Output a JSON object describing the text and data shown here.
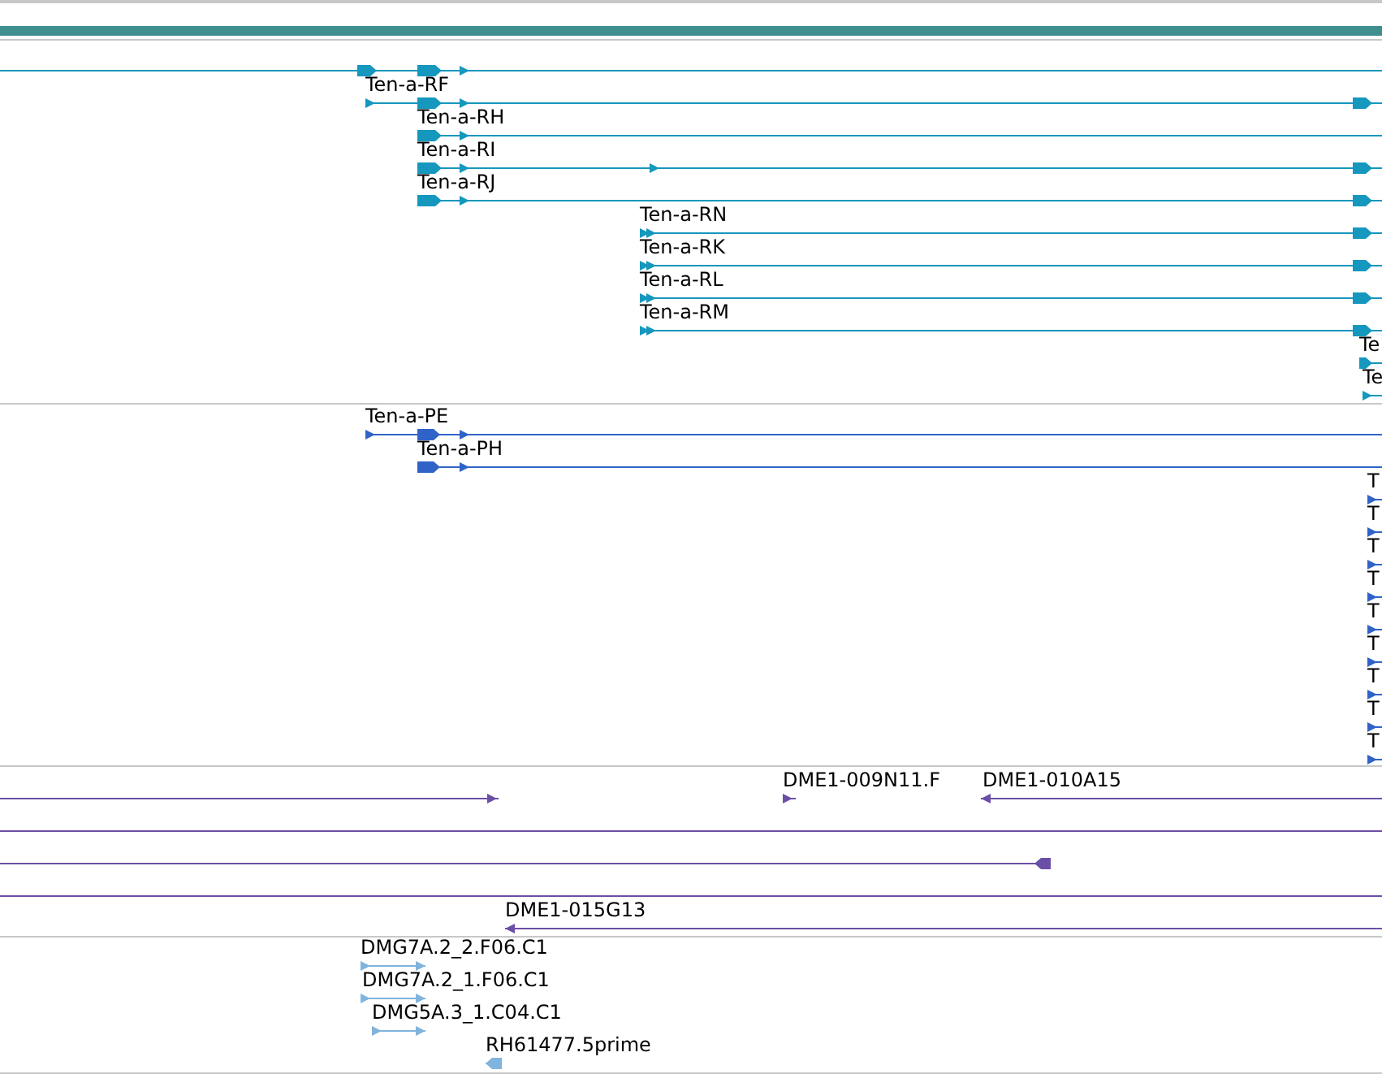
{
  "tracks": [
    {
      "color": "#1597be",
      "features": [
        {
          "kind": "gene",
          "reverse": false
        },
        {
          "kind": "gene",
          "reverse": false,
          "label": "Ten-a-RF"
        },
        {
          "kind": "gene",
          "reverse": false,
          "label": "Ten-a-RH"
        },
        {
          "kind": "gene",
          "reverse": false,
          "label": "Ten-a-RI"
        },
        {
          "kind": "gene",
          "reverse": false,
          "label": "Ten-a-RJ"
        },
        {
          "kind": "gene",
          "reverse": false,
          "label": "Ten-a-RN"
        },
        {
          "kind": "gene",
          "reverse": false,
          "label": "Ten-a-RK"
        },
        {
          "kind": "gene",
          "reverse": false,
          "label": "Ten-a-RL"
        },
        {
          "kind": "gene",
          "reverse": false,
          "label": "Ten-a-RM"
        },
        {
          "kind": "gene",
          "reverse": false,
          "label": "Te"
        },
        {
          "kind": "gene",
          "reverse": false,
          "label": "Te"
        }
      ]
    },
    {
      "color": "#3063c8",
      "features": [
        {
          "kind": "gene",
          "reverse": false,
          "label": "Ten-a-PE"
        },
        {
          "kind": "gene",
          "reverse": false,
          "label": "Ten-a-PH"
        },
        {
          "kind": "gene",
          "reverse": false,
          "label": "T"
        },
        {
          "kind": "gene",
          "reverse": false,
          "label": "T"
        },
        {
          "kind": "gene",
          "reverse": false,
          "label": "T"
        },
        {
          "kind": "gene",
          "reverse": false,
          "label": "T"
        },
        {
          "kind": "gene",
          "reverse": false,
          "label": "T"
        },
        {
          "kind": "gene",
          "reverse": false,
          "label": "T"
        },
        {
          "kind": "gene",
          "reverse": false,
          "label": "T"
        },
        {
          "kind": "gene",
          "reverse": false,
          "label": "T"
        },
        {
          "kind": "gene",
          "reverse": false,
          "label": "T"
        }
      ]
    },
    {
      "color": "#6b4fa6",
      "features": [
        {
          "kind": "gene",
          "reverse": false
        },
        {
          "kind": "gene",
          "reverse": false,
          "label": "DME1-009N11.F"
        },
        {
          "kind": "gene",
          "reverse": true,
          "label": "DME1-010A15"
        },
        {
          "kind": "span"
        },
        {
          "kind": "gene",
          "reverse": true
        },
        {
          "kind": "span"
        },
        {
          "kind": "gene",
          "reverse": true,
          "label": "DME1-015G13"
        }
      ]
    },
    {
      "color": "#80b4dc",
      "features": [
        {
          "kind": "gene",
          "reverse": false,
          "label": "DMG7A.2_2.F06.C1"
        },
        {
          "kind": "gene",
          "reverse": false,
          "label": "DMG7A.2_1.F06.C1"
        },
        {
          "kind": "gene",
          "reverse": false,
          "label": "DMG5A.3_1.C04.C1"
        },
        {
          "kind": "gene",
          "reverse": true,
          "label": "RH61477.5prime"
        }
      ]
    }
  ]
}
